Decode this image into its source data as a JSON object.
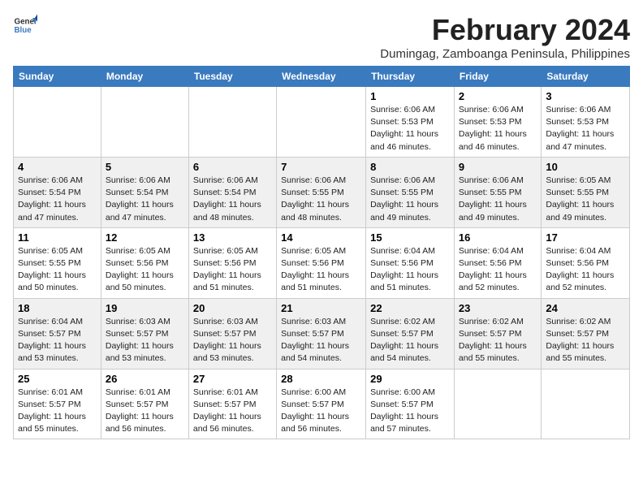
{
  "logo": {
    "text_general": "General",
    "text_blue": "Blue"
  },
  "title": "February 2024",
  "subtitle": "Dumingag, Zamboanga Peninsula, Philippines",
  "days_of_week": [
    "Sunday",
    "Monday",
    "Tuesday",
    "Wednesday",
    "Thursday",
    "Friday",
    "Saturday"
  ],
  "weeks": [
    {
      "shaded": false,
      "days": [
        {
          "num": "",
          "sunrise": "",
          "sunset": "",
          "daylight": ""
        },
        {
          "num": "",
          "sunrise": "",
          "sunset": "",
          "daylight": ""
        },
        {
          "num": "",
          "sunrise": "",
          "sunset": "",
          "daylight": ""
        },
        {
          "num": "",
          "sunrise": "",
          "sunset": "",
          "daylight": ""
        },
        {
          "num": "1",
          "sunrise": "Sunrise: 6:06 AM",
          "sunset": "Sunset: 5:53 PM",
          "daylight": "Daylight: 11 hours and 46 minutes."
        },
        {
          "num": "2",
          "sunrise": "Sunrise: 6:06 AM",
          "sunset": "Sunset: 5:53 PM",
          "daylight": "Daylight: 11 hours and 46 minutes."
        },
        {
          "num": "3",
          "sunrise": "Sunrise: 6:06 AM",
          "sunset": "Sunset: 5:53 PM",
          "daylight": "Daylight: 11 hours and 47 minutes."
        }
      ]
    },
    {
      "shaded": true,
      "days": [
        {
          "num": "4",
          "sunrise": "Sunrise: 6:06 AM",
          "sunset": "Sunset: 5:54 PM",
          "daylight": "Daylight: 11 hours and 47 minutes."
        },
        {
          "num": "5",
          "sunrise": "Sunrise: 6:06 AM",
          "sunset": "Sunset: 5:54 PM",
          "daylight": "Daylight: 11 hours and 47 minutes."
        },
        {
          "num": "6",
          "sunrise": "Sunrise: 6:06 AM",
          "sunset": "Sunset: 5:54 PM",
          "daylight": "Daylight: 11 hours and 48 minutes."
        },
        {
          "num": "7",
          "sunrise": "Sunrise: 6:06 AM",
          "sunset": "Sunset: 5:55 PM",
          "daylight": "Daylight: 11 hours and 48 minutes."
        },
        {
          "num": "8",
          "sunrise": "Sunrise: 6:06 AM",
          "sunset": "Sunset: 5:55 PM",
          "daylight": "Daylight: 11 hours and 49 minutes."
        },
        {
          "num": "9",
          "sunrise": "Sunrise: 6:06 AM",
          "sunset": "Sunset: 5:55 PM",
          "daylight": "Daylight: 11 hours and 49 minutes."
        },
        {
          "num": "10",
          "sunrise": "Sunrise: 6:05 AM",
          "sunset": "Sunset: 5:55 PM",
          "daylight": "Daylight: 11 hours and 49 minutes."
        }
      ]
    },
    {
      "shaded": false,
      "days": [
        {
          "num": "11",
          "sunrise": "Sunrise: 6:05 AM",
          "sunset": "Sunset: 5:55 PM",
          "daylight": "Daylight: 11 hours and 50 minutes."
        },
        {
          "num": "12",
          "sunrise": "Sunrise: 6:05 AM",
          "sunset": "Sunset: 5:56 PM",
          "daylight": "Daylight: 11 hours and 50 minutes."
        },
        {
          "num": "13",
          "sunrise": "Sunrise: 6:05 AM",
          "sunset": "Sunset: 5:56 PM",
          "daylight": "Daylight: 11 hours and 51 minutes."
        },
        {
          "num": "14",
          "sunrise": "Sunrise: 6:05 AM",
          "sunset": "Sunset: 5:56 PM",
          "daylight": "Daylight: 11 hours and 51 minutes."
        },
        {
          "num": "15",
          "sunrise": "Sunrise: 6:04 AM",
          "sunset": "Sunset: 5:56 PM",
          "daylight": "Daylight: 11 hours and 51 minutes."
        },
        {
          "num": "16",
          "sunrise": "Sunrise: 6:04 AM",
          "sunset": "Sunset: 5:56 PM",
          "daylight": "Daylight: 11 hours and 52 minutes."
        },
        {
          "num": "17",
          "sunrise": "Sunrise: 6:04 AM",
          "sunset": "Sunset: 5:56 PM",
          "daylight": "Daylight: 11 hours and 52 minutes."
        }
      ]
    },
    {
      "shaded": true,
      "days": [
        {
          "num": "18",
          "sunrise": "Sunrise: 6:04 AM",
          "sunset": "Sunset: 5:57 PM",
          "daylight": "Daylight: 11 hours and 53 minutes."
        },
        {
          "num": "19",
          "sunrise": "Sunrise: 6:03 AM",
          "sunset": "Sunset: 5:57 PM",
          "daylight": "Daylight: 11 hours and 53 minutes."
        },
        {
          "num": "20",
          "sunrise": "Sunrise: 6:03 AM",
          "sunset": "Sunset: 5:57 PM",
          "daylight": "Daylight: 11 hours and 53 minutes."
        },
        {
          "num": "21",
          "sunrise": "Sunrise: 6:03 AM",
          "sunset": "Sunset: 5:57 PM",
          "daylight": "Daylight: 11 hours and 54 minutes."
        },
        {
          "num": "22",
          "sunrise": "Sunrise: 6:02 AM",
          "sunset": "Sunset: 5:57 PM",
          "daylight": "Daylight: 11 hours and 54 minutes."
        },
        {
          "num": "23",
          "sunrise": "Sunrise: 6:02 AM",
          "sunset": "Sunset: 5:57 PM",
          "daylight": "Daylight: 11 hours and 55 minutes."
        },
        {
          "num": "24",
          "sunrise": "Sunrise: 6:02 AM",
          "sunset": "Sunset: 5:57 PM",
          "daylight": "Daylight: 11 hours and 55 minutes."
        }
      ]
    },
    {
      "shaded": false,
      "days": [
        {
          "num": "25",
          "sunrise": "Sunrise: 6:01 AM",
          "sunset": "Sunset: 5:57 PM",
          "daylight": "Daylight: 11 hours and 55 minutes."
        },
        {
          "num": "26",
          "sunrise": "Sunrise: 6:01 AM",
          "sunset": "Sunset: 5:57 PM",
          "daylight": "Daylight: 11 hours and 56 minutes."
        },
        {
          "num": "27",
          "sunrise": "Sunrise: 6:01 AM",
          "sunset": "Sunset: 5:57 PM",
          "daylight": "Daylight: 11 hours and 56 minutes."
        },
        {
          "num": "28",
          "sunrise": "Sunrise: 6:00 AM",
          "sunset": "Sunset: 5:57 PM",
          "daylight": "Daylight: 11 hours and 56 minutes."
        },
        {
          "num": "29",
          "sunrise": "Sunrise: 6:00 AM",
          "sunset": "Sunset: 5:57 PM",
          "daylight": "Daylight: 11 hours and 57 minutes."
        },
        {
          "num": "",
          "sunrise": "",
          "sunset": "",
          "daylight": ""
        },
        {
          "num": "",
          "sunrise": "",
          "sunset": "",
          "daylight": ""
        }
      ]
    }
  ]
}
